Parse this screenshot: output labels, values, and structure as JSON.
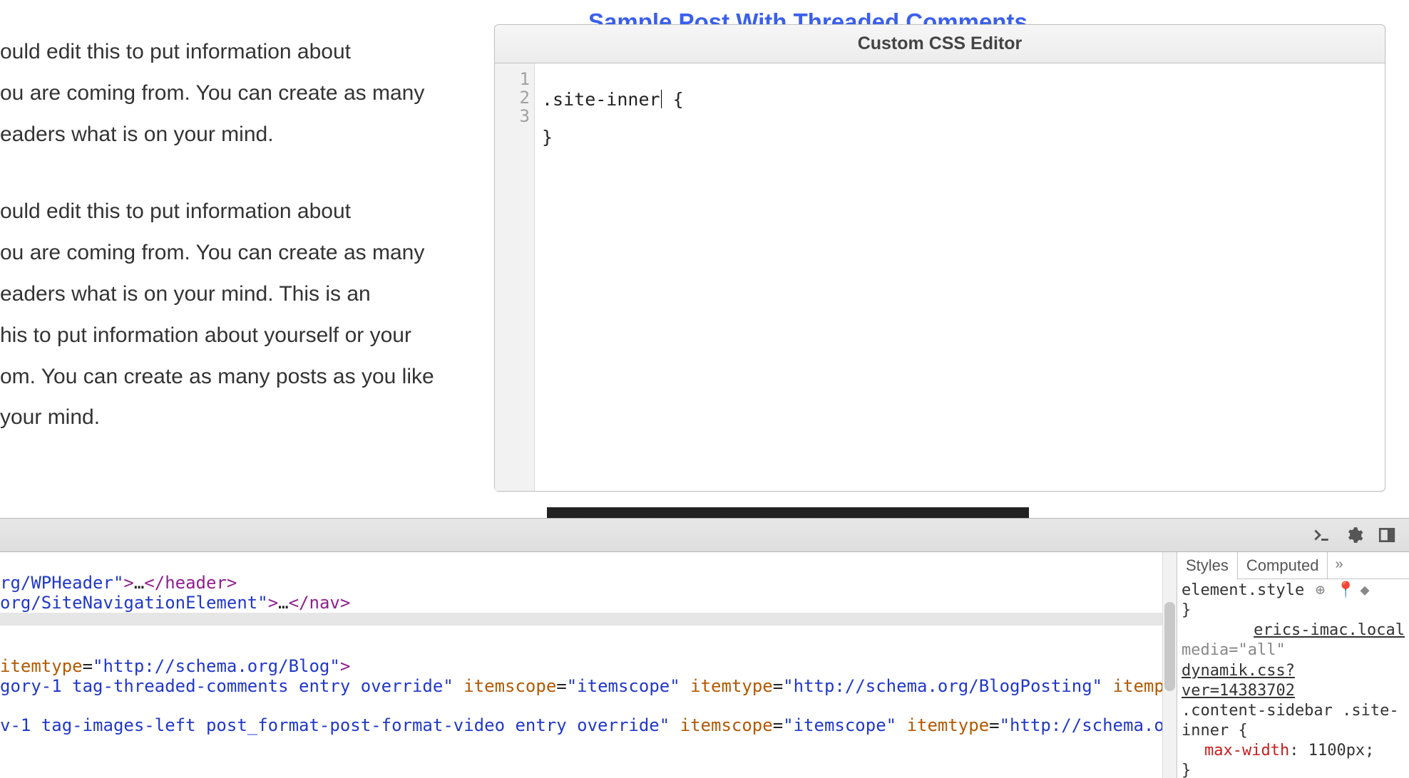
{
  "page": {
    "blue_title": "Sample Post With Threaded Comments",
    "para1": "ould edit this to put information about\nou are coming from. You can create as many\neaders what is on your mind.",
    "para2": "ould edit this to put information about\nou are coming from. You can create as many\neaders what is on your mind. This is an\nhis to put information about yourself or your\nom. You can create as many posts as you like\n your mind."
  },
  "css_editor": {
    "title": "Custom CSS Editor",
    "gutter": [
      "1",
      "2",
      "3"
    ],
    "line1_pre": ".site-inner",
    "line1_post": " {",
    "line2": "",
    "line3": "}"
  },
  "devtools": {
    "tabs": {
      "styles": "Styles",
      "computed": "Computed"
    },
    "overflow": "»",
    "element_style_label": "element.style",
    "brace_open": " {",
    "brace_close": "}",
    "source_link": "erics-imac.local",
    "media_rule": "media=\"all\"",
    "stylesheet_link": "dynamik.css?ver=14383702",
    "rule_selector": ".content-sidebar .site-inner {",
    "rule_prop": "max-width",
    "rule_val": ": 1100px;",
    "rule_close": "}"
  },
  "html_lines": {
    "l1": {
      "pre": "rg/WPHeader\"",
      "tag": "header"
    },
    "l2": {
      "pre": "org/SiteNavigationElement\"",
      "tag": "nav"
    },
    "l3": {
      "attr1": "itemtype",
      "val1": "\"http://schema.org/Blog\""
    },
    "l4": {
      "pre": "gory-1 tag-threaded-comments entry override\"",
      "a1": "itemscope",
      "v1": "\"itemscope\"",
      "a2": "itemtype",
      "v2": "\"http://schema.org/BlogPosting\"",
      "a3": "itemprop"
    },
    "l5": {
      "pre": "v-1 tag-images-left post_format-post-format-video entry override\"",
      "a1": "itemscope",
      "v1": "\"itemscope\"",
      "a2": "itemtype",
      "v2": "\"http://schema.org/"
    }
  }
}
